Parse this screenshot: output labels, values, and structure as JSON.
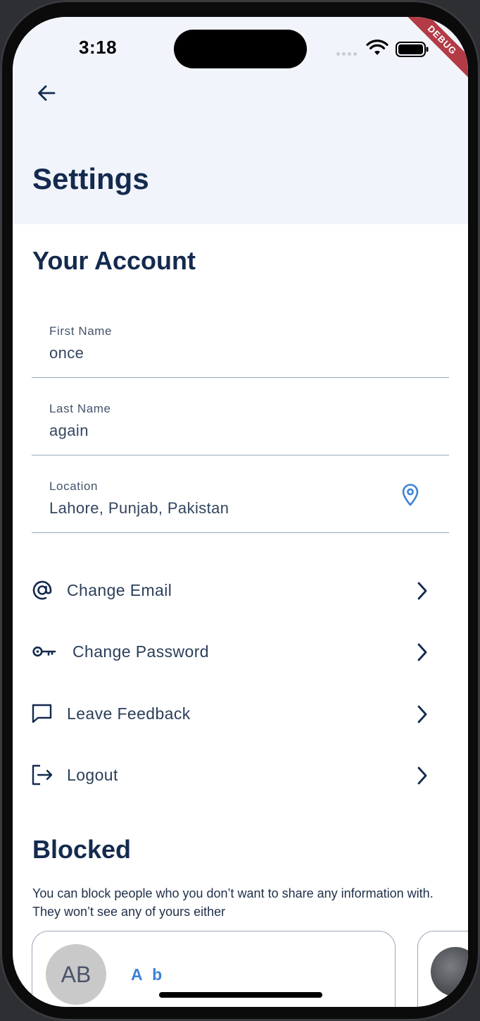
{
  "status_bar": {
    "time": "3:18",
    "debug_label": "DEBUG"
  },
  "header": {
    "title": "Settings"
  },
  "account": {
    "section_title": "Your Account",
    "fields": [
      {
        "label": "First Name",
        "value": "once"
      },
      {
        "label": "Last Name",
        "value": "again"
      },
      {
        "label": "Location",
        "value": "Lahore, Punjab, Pakistan"
      }
    ]
  },
  "menu": [
    {
      "label": "Change Email",
      "icon": "at-icon"
    },
    {
      "label": "Change Password",
      "icon": "key-icon"
    },
    {
      "label": "Leave Feedback",
      "icon": "chat-bubble-icon"
    },
    {
      "label": "Logout",
      "icon": "logout-icon"
    }
  ],
  "blocked": {
    "section_title": "Blocked",
    "description": "You can block people who you don’t want to share any information with. They won’t see any of yours either",
    "users": [
      {
        "initials": "AB",
        "name": "A b"
      }
    ]
  },
  "colors": {
    "primary_text": "#142a4e",
    "accent_blue": "#3c82d8",
    "header_bg": "#f1f5fb",
    "debug_ribbon": "#b33b46"
  }
}
